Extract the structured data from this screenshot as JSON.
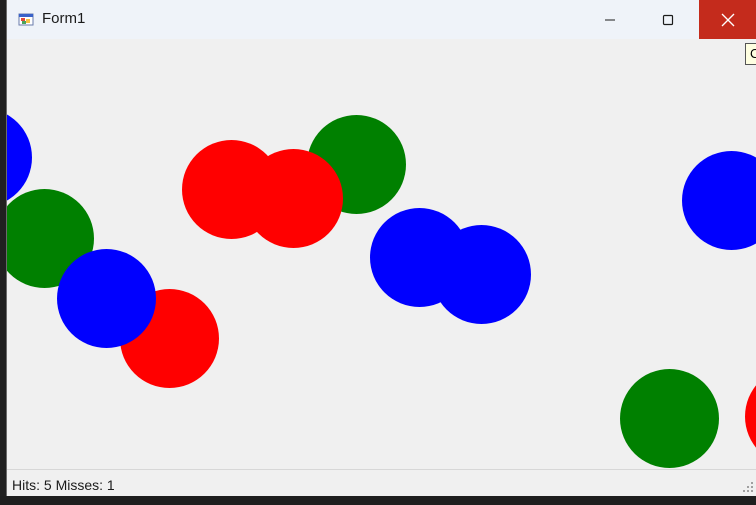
{
  "window": {
    "title": "Form1",
    "controls": {
      "minimize_icon": "minimize-icon",
      "maximize_icon": "maximize-icon",
      "close_icon": "close-icon"
    },
    "close_color": "#c42b1c"
  },
  "tooltip": {
    "text": "C"
  },
  "game": {
    "colors": {
      "red": "#ff0000",
      "green": "#008000",
      "blue": "#0000ff"
    }
  },
  "status": {
    "text": "Hits: 5  Misses: 1"
  }
}
